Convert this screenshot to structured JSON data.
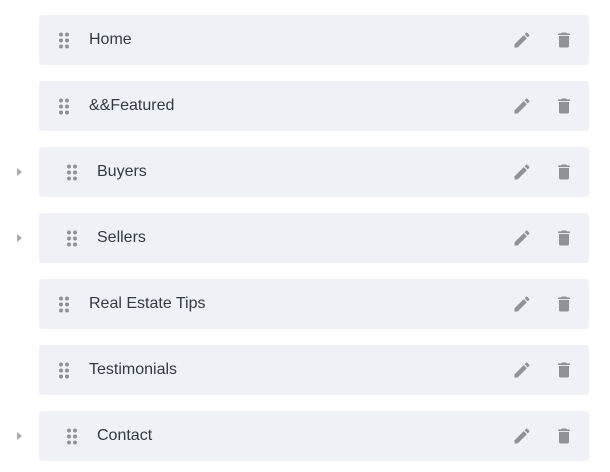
{
  "menu": {
    "items": [
      {
        "label": "Home",
        "has_children": false
      },
      {
        "label": "&&Featured",
        "has_children": false
      },
      {
        "label": "Buyers",
        "has_children": true
      },
      {
        "label": "Sellers",
        "has_children": true
      },
      {
        "label": "Real Estate Tips",
        "has_children": false
      },
      {
        "label": "Testimonials",
        "has_children": false
      },
      {
        "label": "Contact",
        "has_children": true
      }
    ]
  },
  "icons": {
    "expand": "caret-right-icon",
    "handle": "drag-handle-icon",
    "edit": "pencil-icon",
    "delete": "trash-icon"
  },
  "colors": {
    "card_background": "#eef2f6",
    "icon": "#8f9296",
    "caret": "#a6a9ad",
    "text": "#333a42"
  }
}
